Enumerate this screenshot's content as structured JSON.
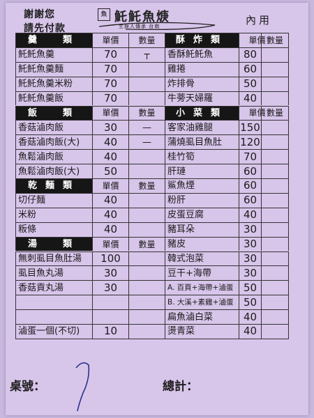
{
  "header": {
    "thanks": "謝謝您",
    "pay_first": "請先付款",
    "shop_name": "魠魠魚焿",
    "shop_sub": "生焿人傳承 台南",
    "dine_in": "內用"
  },
  "columns": {
    "price": "單價",
    "qty": "數量"
  },
  "left": {
    "soup_title": "羹　類",
    "soup": [
      {
        "name": "魠魠魚羹",
        "price": "70",
        "qty": "┬"
      },
      {
        "name": "魠魠魚羹麵",
        "price": "70",
        "qty": ""
      },
      {
        "name": "魠魠魚羹米粉",
        "price": "70",
        "qty": ""
      },
      {
        "name": "魠魠魚羹飯",
        "price": "70",
        "qty": ""
      }
    ],
    "rice_title": "飯　類",
    "rice": [
      {
        "name": "香菇滷肉飯",
        "price": "30",
        "qty": "—"
      },
      {
        "name": "香菇滷肉飯(大)",
        "price": "40",
        "qty": "—"
      },
      {
        "name": "魚鬆滷肉飯",
        "price": "40",
        "qty": ""
      },
      {
        "name": "魚鬆滷肉飯(大)",
        "price": "50",
        "qty": ""
      }
    ],
    "noodle_title": "乾麵類",
    "noodle": [
      {
        "name": "切仔麵",
        "price": "40",
        "qty": ""
      },
      {
        "name": "米粉",
        "price": "40",
        "qty": ""
      },
      {
        "name": "粄條",
        "price": "40",
        "qty": ""
      }
    ],
    "broth_title": "湯　類",
    "broth": [
      {
        "name": "無刺虱目魚肚湯",
        "price": "100",
        "qty": ""
      },
      {
        "name": "虱目魚丸湯",
        "price": "30",
        "qty": ""
      },
      {
        "name": "香菇貢丸湯",
        "price": "30",
        "qty": ""
      },
      {
        "name": "",
        "price": "",
        "qty": ""
      },
      {
        "name": "",
        "price": "",
        "qty": ""
      },
      {
        "name": "滷蛋一個(不切)",
        "price": "10",
        "qty": ""
      }
    ]
  },
  "right": {
    "fried_title": "酥炸類",
    "fried": [
      {
        "name": "香酥魠魠魚",
        "price": "80",
        "qty": ""
      },
      {
        "name": "雞捲",
        "price": "60",
        "qty": ""
      },
      {
        "name": "炸排骨",
        "price": "50",
        "qty": ""
      },
      {
        "name": "牛蒡天婦羅",
        "price": "40",
        "qty": ""
      }
    ],
    "side_title": "小菜類",
    "side": [
      {
        "name": "客家油雞腿",
        "price": "150",
        "qty": ""
      },
      {
        "name": "蒲燒虱目魚肚",
        "price": "120",
        "qty": ""
      },
      {
        "name": "桂竹筍",
        "price": "70",
        "qty": ""
      },
      {
        "name": "肝璉",
        "price": "60",
        "qty": ""
      },
      {
        "name": "鯊魚煙",
        "price": "60",
        "qty": ""
      },
      {
        "name": "粉肝",
        "price": "60",
        "qty": ""
      },
      {
        "name": "皮蛋豆腐",
        "price": "40",
        "qty": ""
      },
      {
        "name": "豬耳朵",
        "price": "30",
        "qty": ""
      },
      {
        "name": "豬皮",
        "price": "30",
        "qty": ""
      },
      {
        "name": "韓式泡菜",
        "price": "30",
        "qty": ""
      },
      {
        "name": "豆干+海帶",
        "price": "30",
        "qty": ""
      },
      {
        "name": "A. 百頁+海帶+滷蛋",
        "price": "50",
        "qty": ""
      },
      {
        "name": "B. 大溪+素雞+滷蛋",
        "price": "50",
        "qty": ""
      },
      {
        "name": "扁魚滷白菜",
        "price": "40",
        "qty": ""
      },
      {
        "name": "燙青菜",
        "price": "40",
        "qty": ""
      }
    ]
  },
  "footer": {
    "table_no": "桌號：",
    "table_value": "7",
    "total": "總計："
  }
}
